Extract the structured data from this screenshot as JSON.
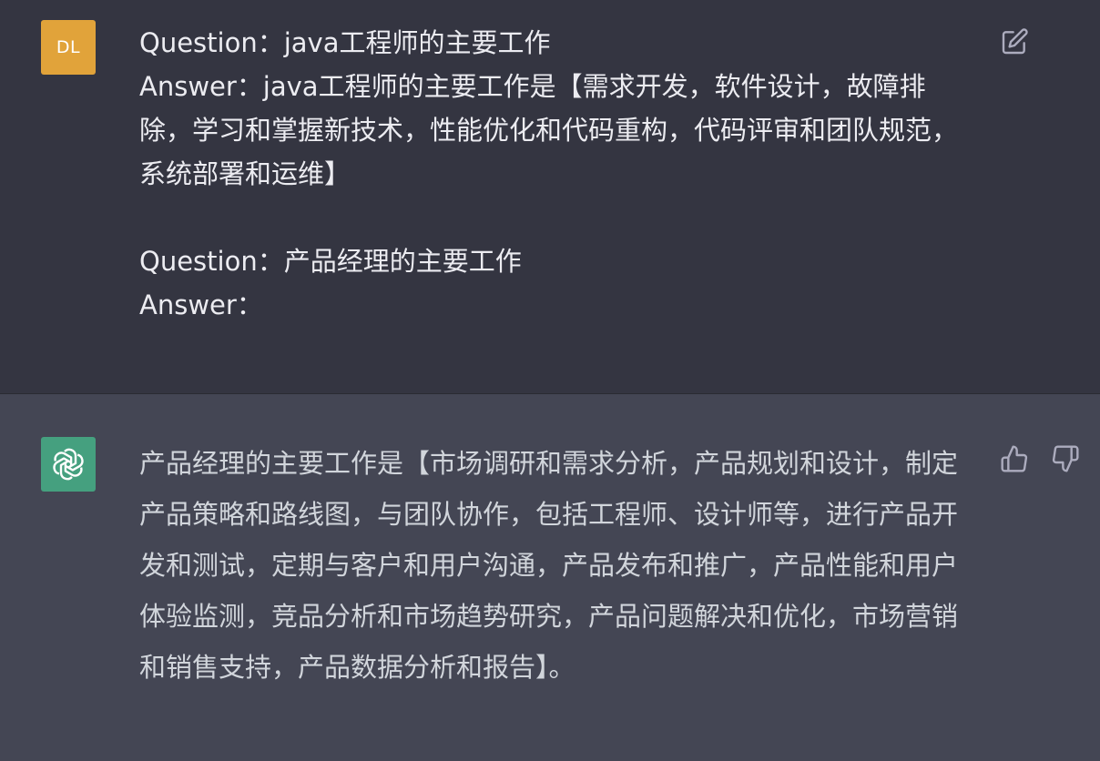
{
  "user_turn": {
    "avatar_initials": "DL",
    "avatar_color": "#e1a33a",
    "message": "Question：java工程师的主要工作\nAnswer：java工程师的主要工作是【需求开发，软件设计，故障排除，学习和掌握新技术，性能优化和代码重构，代码评审和团队规范，系统部署和运维】\n\nQuestion：产品经理的主要工作\nAnswer："
  },
  "assistant_turn": {
    "avatar_icon": "openai-logo-icon",
    "avatar_color": "#45a07f",
    "message": "产品经理的主要工作是【市场调研和需求分析，产品规划和设计，制定产品策略和路线图，与团队协作，包括工程师、设计师等，进行产品开发和测试，定期与客户和用户沟通，产品发布和推广，产品性能和用户体验监测，竞品分析和市场趋势研究，产品问题解决和优化，市场营销和销售支持，产品数据分析和报告】。"
  },
  "icons": {
    "edit": "edit-icon",
    "thumbs_up": "thumbs-up-icon",
    "thumbs_down": "thumbs-down-icon"
  },
  "colors": {
    "user_bg": "#343541",
    "assistant_bg": "#444654",
    "text": "#ececf1"
  }
}
